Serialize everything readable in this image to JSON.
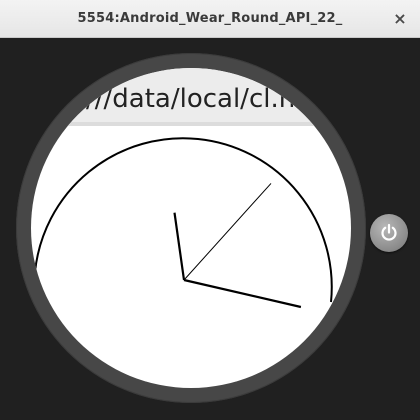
{
  "window": {
    "title": "5554:Android_Wear_Round_API_22_",
    "close_glyph": "×"
  },
  "emulator": {
    "url_text": "///data/local/cl.h",
    "clock": {
      "hour_hand_angle_deg": -8,
      "minute_hand_angle_deg": 103,
      "second_hand_angle_deg": 42
    },
    "power_button_icon": "power-icon"
  }
}
